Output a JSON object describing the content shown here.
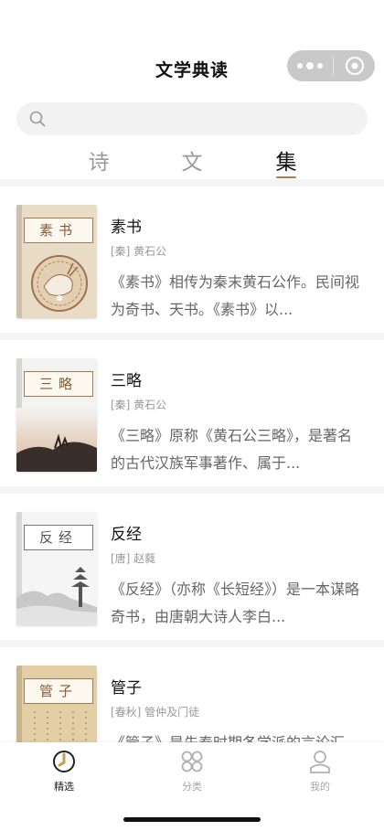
{
  "header": {
    "title": "文学典读"
  },
  "search": {
    "placeholder": ""
  },
  "tabs": [
    {
      "label": "诗",
      "active": false
    },
    {
      "label": "文",
      "active": false
    },
    {
      "label": "集",
      "active": true
    }
  ],
  "books": [
    {
      "title": "素书",
      "cover_label": "素书",
      "author": "[秦] 黄石公",
      "desc": "《素书》相传为秦末黄石公作。民间视为奇书、天书。《素书》以..."
    },
    {
      "title": "三略",
      "cover_label": "三略",
      "author": "[秦] 黄石公",
      "desc": "《三略》原称《黄石公三略》，是著名的古代汉族军事著作、属于..."
    },
    {
      "title": "反经",
      "cover_label": "反经",
      "author": "[唐] 赵蕤",
      "desc": "《反经》（亦称《长短经》）是一本谋略奇书，由唐朝大诗人李白..."
    },
    {
      "title": "管子",
      "cover_label": "管子",
      "author": "[春秋] 管仲及门徒",
      "desc": "《管子》是先秦时期各学派的言论汇编，内容博大精深..."
    }
  ],
  "bottom_nav": [
    {
      "label": "精选",
      "icon": "book-icon",
      "active": true
    },
    {
      "label": "分类",
      "icon": "grid-icon",
      "active": false
    },
    {
      "label": "我的",
      "icon": "person-icon",
      "active": false
    }
  ],
  "colors": {
    "accent": "#b77a45",
    "text_muted": "#999999",
    "divider": "#f4f4f4"
  }
}
